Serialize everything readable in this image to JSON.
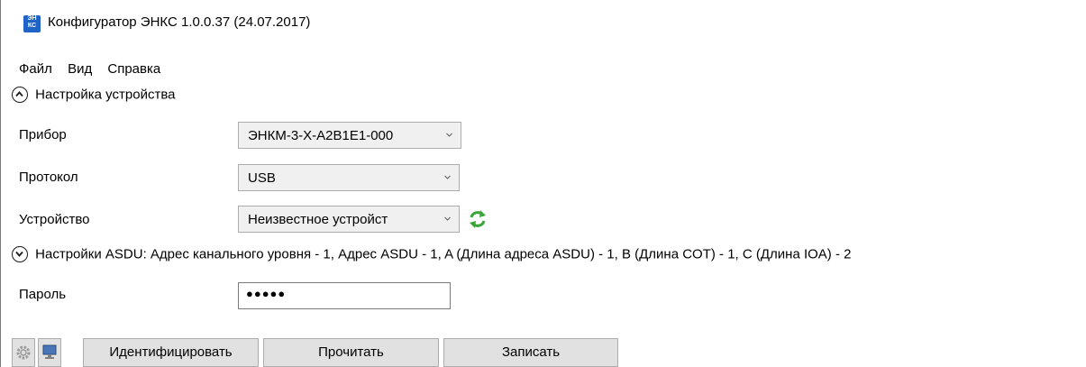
{
  "window": {
    "title": "Конфигуратор ЭНКС 1.0.0.37 (24.07.2017)",
    "icon_text_top": "ЭН",
    "icon_text_bottom": "КС",
    "icon_name": "app-icon"
  },
  "menu": [
    "Файл",
    "Вид",
    "Справка"
  ],
  "device_section": {
    "label": "Настройка устройства",
    "icon": "chevron-up-circle-icon"
  },
  "fields": {
    "device_label": "Прибор",
    "device_value": "ЭНКМ-3-Х-А2В1Е1-000",
    "protocol_label": "Протокол",
    "protocol_value": "USB",
    "target_label": "Устройство",
    "target_value": "Неизвестное устройст",
    "refresh_icon": "refresh-icon"
  },
  "asdu_section": {
    "label": "Настройки ASDU: Адрес канального уровня - 1, Адрес ASDU - 1, A (Длина адреса ASDU) - 1, B (Длина COT) - 1, C (Длина IOA) - 2",
    "icon": "chevron-down-circle-icon"
  },
  "password": {
    "label": "Пароль",
    "masked_value": "●●●●●"
  },
  "toolbar": {
    "settings_icon": "gear-icon",
    "monitor_icon": "monitor-icon",
    "identify_label": "Идентифицировать",
    "read_label": "Прочитать",
    "write_label": "Записать"
  },
  "colors": {
    "icon_blue": "#1f63c6",
    "refresh_green": "#3aa63a",
    "button_face": "#e1e1e1",
    "combo_face": "#f0f0f0"
  }
}
